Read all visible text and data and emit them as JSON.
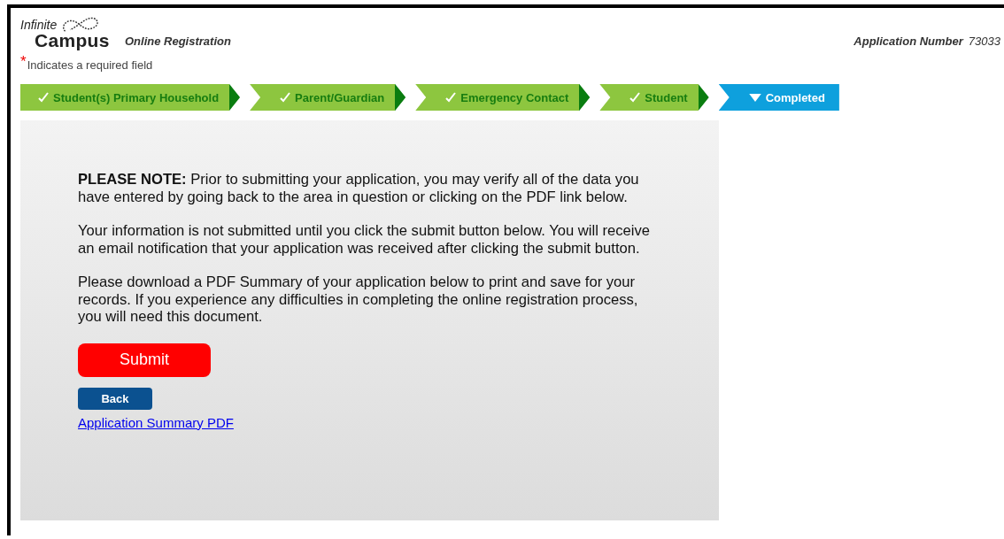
{
  "header": {
    "logo_line_1": "Infinite",
    "logo_line_2": "Campus",
    "title": "Online Registration",
    "application_number_label": "Application Number",
    "application_number": "73033"
  },
  "required_note": {
    "mark": "*",
    "text": "Indicates a required field"
  },
  "steps": [
    {
      "label": "Student(s) Primary Household",
      "completed": true,
      "selected": false
    },
    {
      "label": "Parent/Guardian",
      "completed": true,
      "selected": false
    },
    {
      "label": "Emergency Contact",
      "completed": true,
      "selected": false
    },
    {
      "label": "Student",
      "completed": true,
      "selected": false
    },
    {
      "label": "Completed",
      "completed": false,
      "selected": true
    }
  ],
  "paragraphs": [
    "**PLEASE NOTE:** Prior to submitting your application, you may verify all of the data you have entered by going back to the area in question or clicking on the PDF link below.",
    "Your information is not submitted until you click the submit button below. You will receive an email notification that your application was received after clicking the submit button.",
    "Please download a PDF Summary of your application below to print and save for your records. If you experience any difficulties in completing the online registration process, you will need this document."
  ],
  "submit_button": "Submit",
  "back_button": "Back",
  "pdf_link": "Application Summary PDF"
}
